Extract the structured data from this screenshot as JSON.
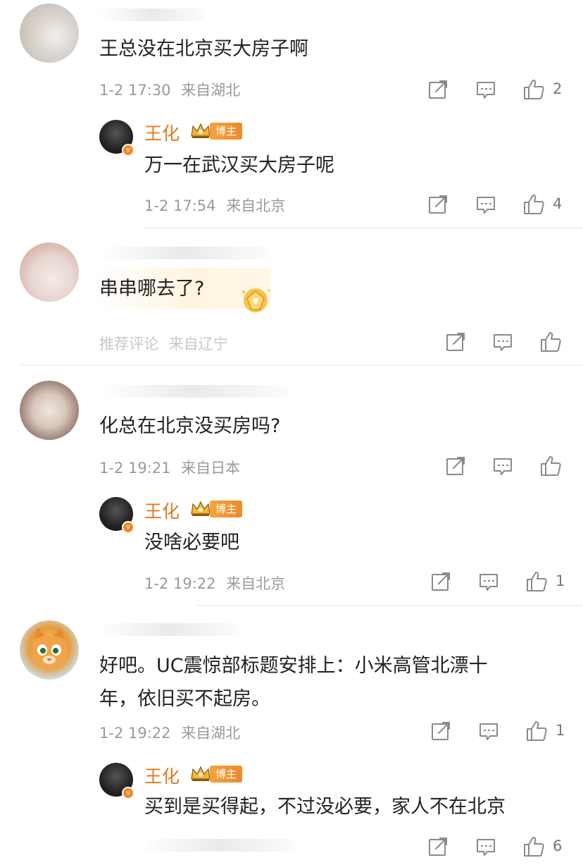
{
  "reply_author": "王化",
  "reply_badge": "博主",
  "comments": [
    {
      "text": "王总没在北京买大房子啊",
      "time": "1-2 17:30",
      "location": "来自湖北",
      "likes": "2",
      "reply": {
        "text": "万一在武汉买大房子呢",
        "time": "1-2 17:54",
        "location": "来自北京",
        "likes": "4"
      }
    },
    {
      "text": "串串哪去了?",
      "tag": "推荐评论",
      "location": "来自辽宁",
      "likes": ""
    },
    {
      "text": "化总在北京没买房吗?",
      "time": "1-2 19:21",
      "location": "来自日本",
      "likes": "",
      "reply": {
        "text": "没啥必要吧",
        "time": "1-2 19:22",
        "location": "来自北京",
        "likes": "1"
      }
    },
    {
      "text_line1": "好吧。UC震惊部标题安排上：小米高管北漂十",
      "text_line2": "年，依旧买不起房。",
      "time": "1-2 19:22",
      "location": "来自湖北",
      "likes": "1",
      "reply": {
        "text": "买到是买得起，不过没必要，家人不在北京",
        "likes": "6"
      }
    }
  ],
  "icons": {
    "share": "share-icon",
    "comment": "comment-icon",
    "like": "thumbs-up-icon",
    "crown": "crown-icon",
    "verified": "verified-icon"
  },
  "colors": {
    "author": "#e07a1f",
    "badge": "#f08e2e",
    "meta": "#9a9a9a",
    "text": "#222222"
  }
}
